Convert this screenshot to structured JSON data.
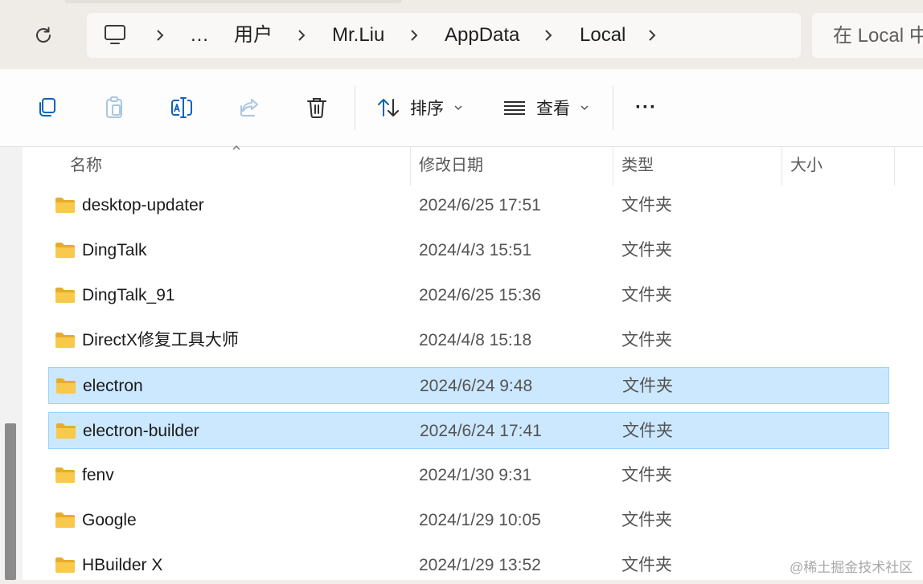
{
  "address_bar": {
    "crumbs": [
      "…",
      "用户",
      "Mr.Liu",
      "AppData",
      "Local"
    ],
    "search_placeholder": "在 Local 中"
  },
  "toolbar": {
    "sort_label": "排序",
    "view_label": "查看",
    "more_label": "···"
  },
  "columns": {
    "name": "名称",
    "modified": "修改日期",
    "type": "类型",
    "size": "大小"
  },
  "files": [
    {
      "name": "desktop-updater",
      "modified": "2024/6/25 17:51",
      "type": "文件夹",
      "selected": false
    },
    {
      "name": "DingTalk",
      "modified": "2024/4/3 15:51",
      "type": "文件夹",
      "selected": false
    },
    {
      "name": "DingTalk_91",
      "modified": "2024/6/25 15:36",
      "type": "文件夹",
      "selected": false
    },
    {
      "name": "DirectX修复工具大师",
      "modified": "2024/4/8 15:18",
      "type": "文件夹",
      "selected": false
    },
    {
      "name": "electron",
      "modified": "2024/6/24 9:48",
      "type": "文件夹",
      "selected": true
    },
    {
      "name": "electron-builder",
      "modified": "2024/6/24 17:41",
      "type": "文件夹",
      "selected": true
    },
    {
      "name": "fenv",
      "modified": "2024/1/30 9:31",
      "type": "文件夹",
      "selected": false
    },
    {
      "name": "Google",
      "modified": "2024/1/29 10:05",
      "type": "文件夹",
      "selected": false
    },
    {
      "name": "HBuilder X",
      "modified": "2024/1/29 13:52",
      "type": "文件夹",
      "selected": false
    }
  ],
  "watermark": "@稀土掘金技术社区",
  "colors": {
    "selection_bg": "#cce8ff",
    "selection_border": "#99d1ff",
    "folder": "#f8c94a"
  }
}
